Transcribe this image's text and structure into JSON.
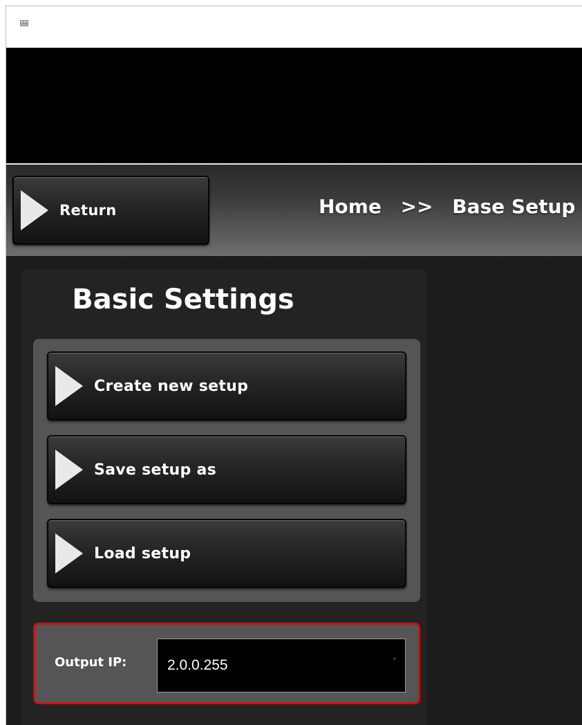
{
  "navbar": {
    "return_label": "Return",
    "breadcrumb": [
      "Home",
      ">>",
      "Base Setup"
    ]
  },
  "panel": {
    "title": "Basic Settings",
    "buttons": [
      {
        "label": "Create new setup"
      },
      {
        "label": "Save setup as"
      },
      {
        "label": "Load setup"
      }
    ]
  },
  "output_ip": {
    "label": "Output IP:",
    "value": "2.0.0.255"
  },
  "icons": {
    "app": "app-icon",
    "arrow": "play-arrow-icon",
    "dropdown": "chevron-down-icon"
  },
  "colors": {
    "highlight": "#d01010",
    "background": "#1b1b1b"
  }
}
